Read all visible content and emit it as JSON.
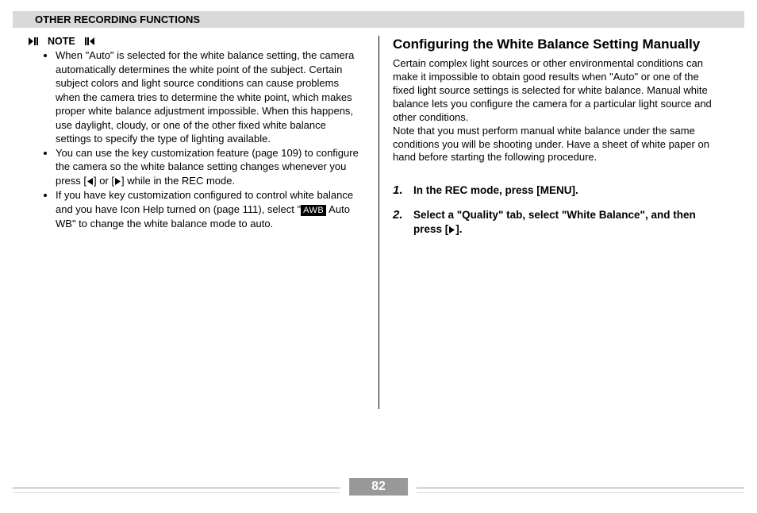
{
  "header": {
    "title": "OTHER RECORDING FUNCTIONS"
  },
  "left": {
    "note_label": "NOTE",
    "bullets": [
      {
        "text_pre": "When \"Auto\" is selected for the white balance setting, the camera automatically determines the white point of the subject. Certain subject colors and light source conditions can cause problems when the camera tries to determine the white point, which makes proper white balance adjustment impossible. When this happens, use daylight, cloudy, or one of the other fixed white balance settings to specify the type of lighting available."
      },
      {
        "text_pre": "You can use the key customization feature (page 109) to configure the camera so the white balance setting changes whenever you press [",
        "after_left_tri": "] or [",
        "after_right_tri": "] while in the REC mode."
      },
      {
        "text_pre": "If you have key customization configured to control white balance and you have Icon Help turned on (page 111), select \"",
        "awb": "AWB",
        "after_awb": " Auto WB\" to change the white balance mode to auto."
      }
    ]
  },
  "right": {
    "title": "Configuring the White Balance Setting Manually",
    "para1": "Certain complex light sources or other environmental conditions can make it impossible to obtain good results when \"Auto\" or one of the fixed light source settings is selected for white balance. Manual white balance lets you configure the camera for a particular light source and other conditions.",
    "para2": "Note that you must perform manual white balance under the same conditions you will be shooting under. Have a sheet of white paper on hand before starting the following procedure.",
    "steps": [
      {
        "num": "1.",
        "text": "In the REC mode, press [MENU]."
      },
      {
        "num": "2.",
        "text_pre": "Select a \"Quality\" tab, select \"White Balance\", and then press [",
        "after_tri": "]."
      }
    ]
  },
  "page_number": "82"
}
